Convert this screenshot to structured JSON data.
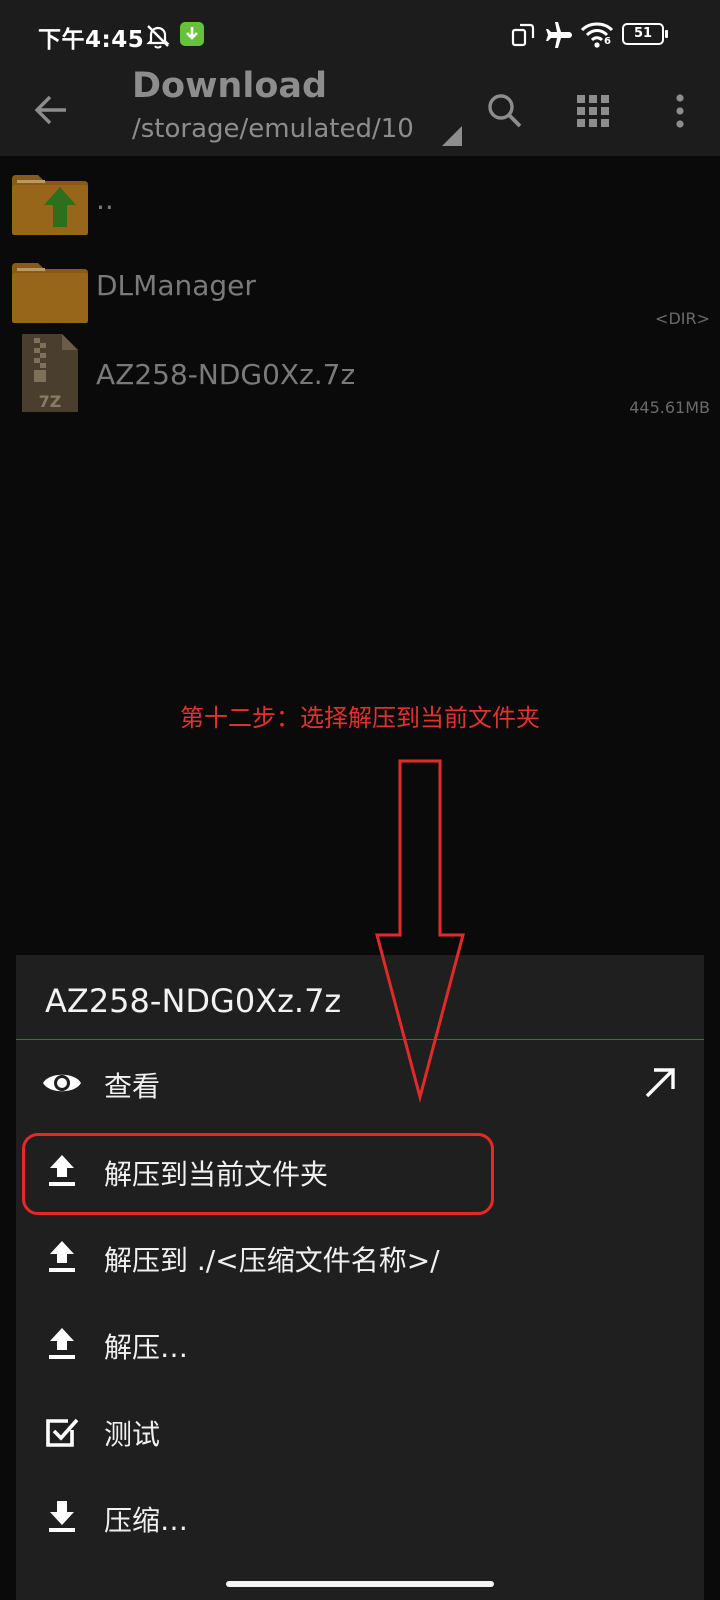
{
  "status_bar": {
    "time": "下午4:45",
    "battery": "51",
    "wifi_label": "6"
  },
  "toolbar": {
    "title": "Download",
    "path": "/storage/emulated/10"
  },
  "files": [
    {
      "name": "..",
      "meta": "",
      "icon": "folder-up-icon"
    },
    {
      "name": "DLManager",
      "meta": "<DIR>",
      "icon": "folder-icon"
    },
    {
      "name": "AZ258-NDG0Xz.7z",
      "meta": "445.61MB",
      "icon": "7z-archive-icon",
      "icon_text": "7Z"
    }
  ],
  "annotation": {
    "text": "第十二步：选择解压到当前文件夹",
    "color": "#e0322f"
  },
  "sheet": {
    "title": "AZ258-NDG0Xz.7z",
    "items": [
      {
        "label": "查看",
        "icon": "eye-icon"
      },
      {
        "label": "解压到当前文件夹",
        "icon": "extract-icon"
      },
      {
        "label": "解压到 ./<压缩文件名称>/",
        "icon": "extract-icon"
      },
      {
        "label": "解压…",
        "icon": "extract-icon"
      },
      {
        "label": "测试",
        "icon": "checkbox-icon"
      },
      {
        "label": "压缩…",
        "icon": "compress-icon"
      }
    ]
  }
}
